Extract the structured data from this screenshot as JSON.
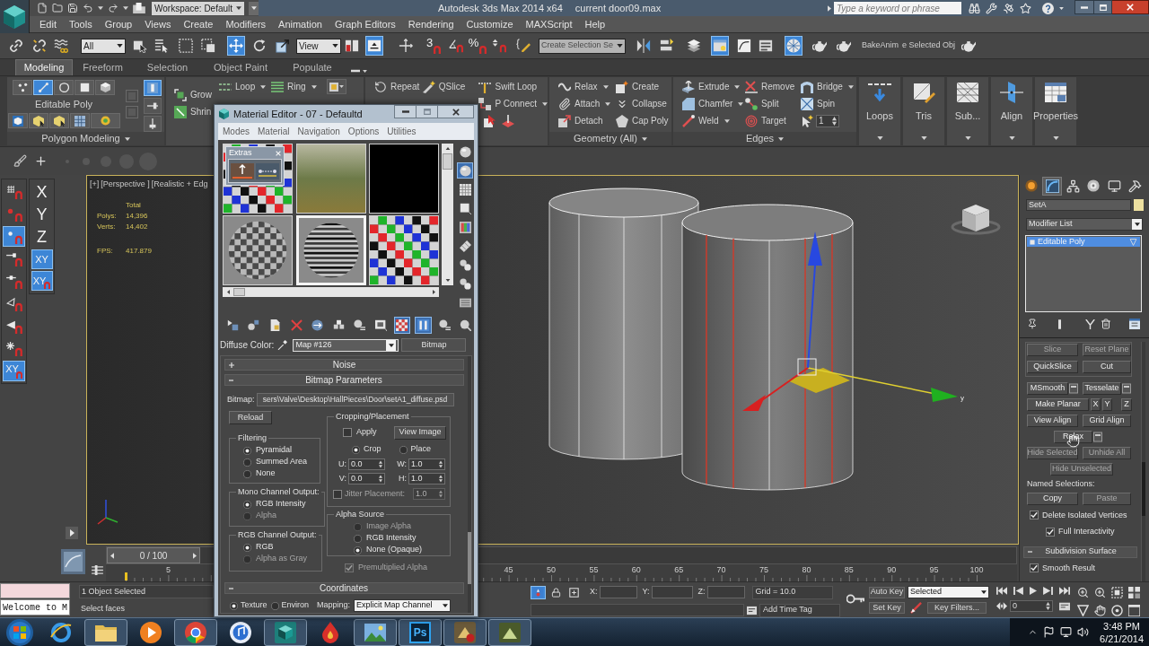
{
  "title_bar": {
    "workspace": "Workspace: Default",
    "app_title": "Autodesk 3ds Max 2014 x64",
    "document": "current door09.max",
    "search": {
      "placeholder": "Type a keyword or phrase"
    }
  },
  "menu_bar": [
    "Edit",
    "Tools",
    "Group",
    "Views",
    "Create",
    "Modifiers",
    "Animation",
    "Graph Editors",
    "Rendering",
    "Customize",
    "MAXScript",
    "Help"
  ],
  "main_toolbar": [
    {
      "kind": "tool",
      "on": false
    },
    {
      "kind": "tool",
      "on": false
    },
    {
      "kind": "tool",
      "on": false
    },
    {
      "kind": "dropdown",
      "value": "All"
    },
    {
      "kind": "tool",
      "on": false
    },
    {
      "kind": "tool",
      "on": false
    },
    {
      "kind": "tool",
      "on": false
    },
    {
      "kind": "tool",
      "on": false
    },
    {
      "kind": "tool",
      "on": true
    },
    {
      "kind": "tool",
      "on": false
    },
    {
      "kind": "tool",
      "on": false
    },
    {
      "kind": "dropdown",
      "value": "View"
    },
    {
      "kind": "tool",
      "on": false
    },
    {
      "kind": "tool",
      "on": true
    },
    {
      "kind": "tool",
      "on": false
    },
    {
      "kind": "snap",
      "text": "3",
      "on": false
    },
    {
      "kind": "tool",
      "on": false
    },
    {
      "kind": "snap",
      "text": "%",
      "on": false
    },
    {
      "kind": "tool",
      "on": false
    },
    {
      "kind": "tool",
      "on": false
    },
    {
      "kind": "dropdown",
      "value": "Create Selection Se"
    },
    {
      "kind": "tool",
      "on": false
    },
    {
      "kind": "tool",
      "on": false
    },
    {
      "kind": "tool",
      "on": false
    },
    {
      "kind": "tool",
      "on": true
    },
    {
      "kind": "tool",
      "on": false
    },
    {
      "kind": "tool",
      "on": false
    },
    {
      "kind": "tool",
      "on": true
    },
    {
      "kind": "tool",
      "on": false
    },
    {
      "kind": "tool",
      "on": false
    },
    {
      "kind": "label",
      "text": "BakeAnim"
    },
    {
      "kind": "label",
      "text": "e Selected Obj"
    },
    {
      "kind": "tool",
      "on": false
    }
  ],
  "ribbon": {
    "tabs": [
      {
        "label": "Modeling",
        "selected": true
      },
      {
        "label": "Freeform",
        "selected": false
      },
      {
        "label": "Selection",
        "selected": false
      },
      {
        "label": "Object Paint",
        "selected": false
      },
      {
        "label": "Populate",
        "selected": false
      }
    ],
    "polygon_modeling": {
      "subobject_levels": [
        {
          "selected": false
        },
        {
          "selected": true
        },
        {
          "selected": false
        },
        {
          "selected": false
        },
        {
          "selected": false
        }
      ],
      "object": "Editable Poly",
      "title": "Polygon Modeling",
      "side_tools": [
        {
          "on": true
        },
        {
          "on": false
        },
        {
          "on": false
        }
      ]
    },
    "modify_selection": {
      "commands": [
        {
          "label": "Grow",
          "menu": false
        },
        {
          "label": "Shrin",
          "menu": false
        }
      ]
    },
    "loops": {
      "commands": [
        {
          "label": "Loop",
          "menu": true
        },
        {
          "label": "Ring",
          "menu": true
        }
      ]
    },
    "edit": {
      "commands": [
        {
          "label": "Repeat",
          "menu": false
        },
        {
          "label": "QSlice",
          "menu": false
        },
        {
          "label": "Swift Loop",
          "menu": false
        },
        {
          "label": "P Connect",
          "menu": true
        }
      ]
    },
    "geometry": {
      "title": "Geometry (All)",
      "commands": [
        {
          "label": "Relax",
          "menu": true
        },
        {
          "label": "Attach",
          "menu": true
        },
        {
          "label": "Detach",
          "menu": false
        },
        {
          "label": "Create",
          "menu": false
        },
        {
          "label": "Collapse",
          "menu": false
        },
        {
          "label": "Cap Poly",
          "menu": false
        }
      ]
    },
    "edges": {
      "title": "Edges",
      "commands": [
        {
          "label": "Extrude",
          "menu": true
        },
        {
          "label": "Chamfer",
          "menu": true
        },
        {
          "label": "Weld",
          "menu": true
        },
        {
          "label": "Remove",
          "menu": false
        },
        {
          "label": "Split",
          "menu": false
        },
        {
          "label": "Target",
          "menu": false
        },
        {
          "label": "Bridge",
          "menu": true
        },
        {
          "label": "Spin",
          "menu": false
        }
      ],
      "weight": "1"
    },
    "large_buttons": [
      {
        "label": "Loops"
      },
      {
        "label": "Tris"
      },
      {
        "label": "Sub..."
      },
      {
        "label": "Align"
      },
      {
        "label": "Properties"
      }
    ]
  },
  "snaps_toolbar": [
    {
      "kind": "icon",
      "on": false
    },
    {
      "kind": "icon",
      "on": false
    },
    {
      "kind": "icon",
      "on": true
    },
    {
      "kind": "icon",
      "on": false
    },
    {
      "kind": "icon",
      "on": false
    },
    {
      "kind": "icon",
      "on": false
    },
    {
      "kind": "icon",
      "on": false
    },
    {
      "kind": "icon",
      "on": false
    },
    {
      "kind": "text",
      "text": "XY",
      "on": true
    }
  ],
  "axis_constraints": [
    {
      "kind": "axis",
      "label": "X",
      "selected": false
    },
    {
      "kind": "axis",
      "label": "Y",
      "selected": false
    },
    {
      "kind": "axis",
      "label": "Z",
      "selected": false
    },
    {
      "kind": "plane",
      "label": "XY",
      "selected": true
    },
    {
      "kind": "snap",
      "label": "XY",
      "selected": true
    }
  ],
  "viewport": {
    "active": true,
    "labels": [
      "[+]",
      "[Perspective ]",
      "[Realistic + Edg"
    ],
    "stats": {
      "header": "Total",
      "rows": [
        {
          "label": "Polys:",
          "value": "14,396"
        },
        {
          "label": "Verts:",
          "value": "14,402"
        }
      ],
      "fps_label": "FPS:",
      "fps": "417.879"
    },
    "gizmo_label": "y"
  },
  "material_editor": {
    "title": "Material Editor - 07 - Defaultd",
    "menu": [
      "Modes",
      "Material",
      "Navigation",
      "Options",
      "Utilities"
    ],
    "sample_slots": [
      {
        "kind": "checker",
        "selected": false
      },
      {
        "kind": "photo",
        "selected": false
      },
      {
        "kind": "black",
        "selected": false
      },
      {
        "kind": "checker_sphere",
        "selected": false
      },
      {
        "kind": "striped_sphere",
        "selected": true
      },
      {
        "kind": "checker",
        "selected": false
      }
    ],
    "extras_panel": {
      "title": "Extras"
    },
    "side_tools": [
      {
        "on": false
      },
      {
        "on": true
      },
      {
        "on": false
      },
      {
        "on": false
      },
      {
        "on": false
      },
      {
        "on": false
      },
      {
        "on": false
      },
      {
        "on": false
      },
      {
        "on": false
      }
    ],
    "toolbar": [
      {
        "on": false
      },
      {
        "on": false
      },
      {
        "on": false
      },
      {
        "on": false
      },
      {
        "on": false
      },
      {
        "on": false
      },
      {
        "on": false
      },
      {
        "on": false
      },
      {
        "on": true
      },
      {
        "on": true
      },
      {
        "on": false
      },
      {
        "on": false
      }
    ],
    "diffuse": {
      "label": "Diffuse Color:",
      "map": "Map #126",
      "map_type": "Bitmap"
    },
    "rollouts": [
      {
        "title": "Noise",
        "expanded": false
      },
      {
        "title": "Bitmap Parameters",
        "expanded": true
      },
      {
        "title": "Coordinates",
        "expanded": true
      }
    ],
    "bitmap_parameters": {
      "bitmap_label": "Bitmap:",
      "path": "sers\\Valve\\Desktop\\HallPieces\\Door\\setA1_diffuse.psd",
      "reload": "Reload",
      "filtering": {
        "title": "Filtering",
        "options": [
          {
            "label": "Pyramidal",
            "selected": true
          },
          {
            "label": "Summed Area",
            "selected": false
          },
          {
            "label": "None",
            "selected": false
          }
        ]
      },
      "mono_channel_output": {
        "title": "Mono Channel Output:",
        "options": [
          {
            "label": "RGB Intensity",
            "selected": true,
            "disabled": false
          },
          {
            "label": "Alpha",
            "selected": false,
            "disabled": true
          }
        ]
      },
      "rgb_channel_output": {
        "title": "RGB Channel Output:",
        "options": [
          {
            "label": "RGB",
            "selected": true,
            "disabled": false
          },
          {
            "label": "Alpha as Gray",
            "selected": false,
            "disabled": true
          }
        ]
      },
      "cropping_placement": {
        "title": "Cropping/Placement",
        "apply": {
          "label": "Apply",
          "checked": false
        },
        "view_image": "View Image",
        "modes": [
          {
            "label": "Crop",
            "selected": true
          },
          {
            "label": "Place",
            "selected": false
          }
        ],
        "fields": [
          {
            "label": "U:",
            "value": "0.0"
          },
          {
            "label": "W:",
            "value": "1.0"
          },
          {
            "label": "V:",
            "value": "0.0"
          },
          {
            "label": "H:",
            "value": "1.0"
          }
        ],
        "jitter": {
          "label": "Jitter Placement:",
          "checked": false,
          "value": "1.0"
        }
      },
      "alpha_source": {
        "title": "Alpha Source",
        "options": [
          {
            "label": "Image Alpha",
            "selected": false,
            "disabled": true
          },
          {
            "label": "RGB Intensity",
            "selected": false,
            "disabled": false
          },
          {
            "label": "None (Opaque)",
            "selected": true,
            "disabled": false
          }
        ]
      },
      "premultiplied_alpha": {
        "label": "Premultiplied Alpha",
        "checked": true
      }
    },
    "coordinates": {
      "modes": [
        {
          "label": "Texture",
          "selected": true
        },
        {
          "label": "Environ",
          "selected": false
        }
      ],
      "mapping_label": "Mapping:",
      "mapping": "Explicit Map Channel"
    }
  },
  "command_panel": {
    "tabs": [
      {
        "selected": false
      },
      {
        "selected": true
      },
      {
        "selected": false
      },
      {
        "selected": false
      },
      {
        "selected": false
      },
      {
        "selected": false
      }
    ],
    "object_name": "SetA",
    "modifier_list": "Modifier List",
    "stack": [
      {
        "label": "Editable Poly",
        "selected": true
      }
    ],
    "edit_geometry": [
      [
        {
          "label": "Slice",
          "disabled": true,
          "settings": false
        },
        {
          "label": "Reset Plane",
          "disabled": true,
          "settings": false
        }
      ],
      [
        {
          "label": "QuickSlice",
          "disabled": false,
          "settings": false
        },
        {
          "label": "Cut",
          "disabled": false,
          "settings": false
        }
      ],
      [
        {
          "label": "MSmooth",
          "disabled": false,
          "settings": true
        },
        {
          "label": "Tesselate",
          "disabled": false,
          "settings": true
        }
      ],
      [
        {
          "label": "Make Planar",
          "disabled": false,
          "settings": false
        },
        {
          "label": "X",
          "disabled": false,
          "settings": false
        },
        {
          "label": "Y",
          "disabled": false,
          "settings": false
        },
        {
          "label": "Z",
          "disabled": false,
          "settings": false
        }
      ],
      [
        {
          "label": "View Align",
          "disabled": false,
          "settings": false
        },
        {
          "label": "Grid Align",
          "disabled": false,
          "settings": false
        }
      ],
      [
        {
          "label": "Relax",
          "disabled": false,
          "settings": true
        }
      ],
      [
        {
          "label": "Hide Selected",
          "disabled": true,
          "settings": false
        },
        {
          "label": "Unhide All",
          "disabled": true,
          "settings": false
        }
      ],
      [
        {
          "label": "Hide Unselected",
          "disabled": true,
          "settings": false
        }
      ]
    ],
    "named_selections": {
      "title": "Named Selections:",
      "buttons": [
        {
          "label": "Copy",
          "disabled": false
        },
        {
          "label": "Paste",
          "disabled": true
        }
      ]
    },
    "options": [
      {
        "label": "Delete Isolated Vertices",
        "checked": true
      },
      {
        "label": "Full Interactivity",
        "checked": true
      }
    ],
    "subdivision_surface": {
      "title": "Subdivision Surface",
      "expanded": true,
      "options": [
        {
          "label": "Smooth Result",
          "checked": true
        }
      ]
    }
  },
  "time_slider": {
    "position": "0 / 100",
    "level": 0
  },
  "track_bar": {
    "labels_start": [
      "5"
    ],
    "labels_end": [
      "45",
      "50",
      "55",
      "60",
      "65",
      "70",
      "75",
      "80",
      "85",
      "90",
      "95",
      "100"
    ]
  },
  "status_bar": {
    "tools": [
      {
        "on": true
      },
      {
        "on": false
      },
      {
        "on": false
      }
    ],
    "listener_output": "Welcome to M",
    "selection": "1 Object Selected",
    "prompt": "Select faces",
    "coordinates": [
      {
        "label": "X:"
      },
      {
        "label": "Y:"
      },
      {
        "label": "Z:"
      }
    ],
    "grid": "Grid = 10.0",
    "time_tag": "Add Time Tag",
    "auto_key": "Auto Key",
    "key_mode": "Selected",
    "set_key": "Set Key",
    "key_filters": "Key Filters...",
    "frame": "0"
  },
  "taskbar": {
    "apps": [
      {
        "running": false
      },
      {
        "running": true
      },
      {
        "running": false
      },
      {
        "running": true
      },
      {
        "running": false
      },
      {
        "running": true
      },
      {
        "running": false
      },
      {
        "running": true
      },
      {
        "running": true,
        "logo_text": "Ps"
      },
      {
        "running": true
      },
      {
        "running": true
      }
    ],
    "time": "3:48 PM",
    "date": "6/21/2014"
  }
}
